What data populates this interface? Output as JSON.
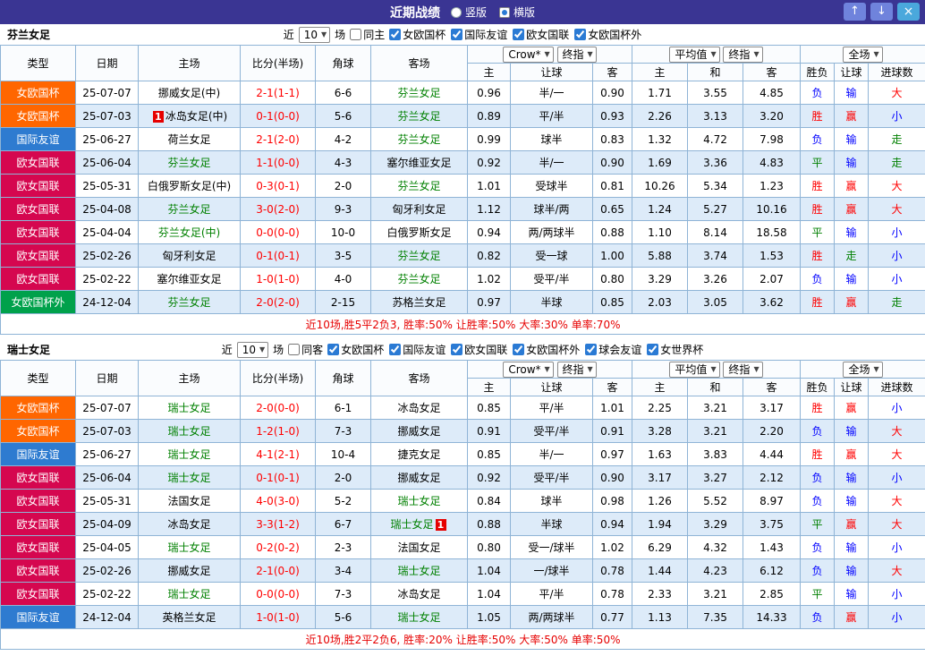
{
  "header": {
    "title": "近期战绩",
    "radios": [
      {
        "label": "竖版",
        "selected": false
      },
      {
        "label": "横版",
        "selected": true
      }
    ],
    "up": "↑",
    "down": "↓",
    "close": "×"
  },
  "type_colors": {
    "女欧国杯": "#ff6600",
    "国际友谊": "#2e7bd0",
    "欧女国联": "#d5074f",
    "女欧国杯外": "#00a14b"
  },
  "table_headers": {
    "type": "类型",
    "date": "日期",
    "home": "主场",
    "score": "比分(半场)",
    "corner": "角球",
    "away": "客场",
    "sub": [
      "主",
      "让球",
      "客",
      "主",
      "和",
      "客",
      "胜负",
      "让球",
      "进球数"
    ],
    "company": "Crow*",
    "final1": "终指",
    "average": "平均值",
    "final2": "终指",
    "scope": "全场"
  },
  "sections": [
    {
      "team": "芬兰女足",
      "filter": {
        "near": "近",
        "count": "10",
        "games": "场",
        "same": "同主",
        "same_checked": false,
        "comps": [
          {
            "label": "女欧国杯",
            "checked": true
          },
          {
            "label": "国际友谊",
            "checked": true
          },
          {
            "label": "欧女国联",
            "checked": true
          },
          {
            "label": "女欧国杯外",
            "checked": true
          }
        ]
      },
      "rows": [
        {
          "type": "女欧国杯",
          "date": "25-07-07",
          "home": "挪威女足(中)",
          "hf": false,
          "hc": 0,
          "score": "2-1(1-1)",
          "corner": "6-6",
          "away": "芬兰女足",
          "af": true,
          "ac": 0,
          "o": [
            "0.96",
            "半/一",
            "0.90",
            "1.71",
            "3.55",
            "4.85"
          ],
          "r": [
            "负",
            "输",
            "大"
          ]
        },
        {
          "type": "女欧国杯",
          "date": "25-07-03",
          "home": "冰岛女足(中)",
          "hf": false,
          "hc": 1,
          "score": "0-1(0-0)",
          "corner": "5-6",
          "away": "芬兰女足",
          "af": true,
          "ac": 0,
          "o": [
            "0.89",
            "平/半",
            "0.93",
            "2.26",
            "3.13",
            "3.20"
          ],
          "r": [
            "胜",
            "赢",
            "小"
          ]
        },
        {
          "type": "国际友谊",
          "date": "25-06-27",
          "home": "荷兰女足",
          "hf": false,
          "hc": 0,
          "score": "2-1(2-0)",
          "corner": "4-2",
          "away": "芬兰女足",
          "af": true,
          "ac": 0,
          "o": [
            "0.99",
            "球半",
            "0.83",
            "1.32",
            "4.72",
            "7.98"
          ],
          "r": [
            "负",
            "输",
            "走"
          ]
        },
        {
          "type": "欧女国联",
          "date": "25-06-04",
          "home": "芬兰女足",
          "hf": true,
          "hc": 0,
          "score": "1-1(0-0)",
          "corner": "4-3",
          "away": "塞尔维亚女足",
          "af": false,
          "ac": 0,
          "o": [
            "0.92",
            "半/一",
            "0.90",
            "1.69",
            "3.36",
            "4.83"
          ],
          "r": [
            "平",
            "输",
            "走"
          ]
        },
        {
          "type": "欧女国联",
          "date": "25-05-31",
          "home": "白俄罗斯女足(中)",
          "hf": false,
          "hc": 0,
          "score": "0-3(0-1)",
          "corner": "2-0",
          "away": "芬兰女足",
          "af": true,
          "ac": 0,
          "o": [
            "1.01",
            "受球半",
            "0.81",
            "10.26",
            "5.34",
            "1.23"
          ],
          "r": [
            "胜",
            "赢",
            "大"
          ]
        },
        {
          "type": "欧女国联",
          "date": "25-04-08",
          "home": "芬兰女足",
          "hf": true,
          "hc": 0,
          "score": "3-0(2-0)",
          "corner": "9-3",
          "away": "匈牙利女足",
          "af": false,
          "ac": 0,
          "o": [
            "1.12",
            "球半/两",
            "0.65",
            "1.24",
            "5.27",
            "10.16"
          ],
          "r": [
            "胜",
            "赢",
            "大"
          ]
        },
        {
          "type": "欧女国联",
          "date": "25-04-04",
          "home": "芬兰女足(中)",
          "hf": true,
          "hc": 0,
          "score": "0-0(0-0)",
          "corner": "10-0",
          "away": "白俄罗斯女足",
          "af": false,
          "ac": 0,
          "o": [
            "0.94",
            "两/两球半",
            "0.88",
            "1.10",
            "8.14",
            "18.58"
          ],
          "r": [
            "平",
            "输",
            "小"
          ]
        },
        {
          "type": "欧女国联",
          "date": "25-02-26",
          "home": "匈牙利女足",
          "hf": false,
          "hc": 0,
          "score": "0-1(0-1)",
          "corner": "3-5",
          "away": "芬兰女足",
          "af": true,
          "ac": 0,
          "o": [
            "0.82",
            "受一球",
            "1.00",
            "5.88",
            "3.74",
            "1.53"
          ],
          "r": [
            "胜",
            "走",
            "小"
          ]
        },
        {
          "type": "欧女国联",
          "date": "25-02-22",
          "home": "塞尔维亚女足",
          "hf": false,
          "hc": 0,
          "score": "1-0(1-0)",
          "corner": "4-0",
          "away": "芬兰女足",
          "af": true,
          "ac": 0,
          "o": [
            "1.02",
            "受平/半",
            "0.80",
            "3.29",
            "3.26",
            "2.07"
          ],
          "r": [
            "负",
            "输",
            "小"
          ]
        },
        {
          "type": "女欧国杯外",
          "date": "24-12-04",
          "home": "芬兰女足",
          "hf": true,
          "hc": 0,
          "score": "2-0(2-0)",
          "corner": "2-15",
          "away": "苏格兰女足",
          "af": false,
          "ac": 0,
          "o": [
            "0.97",
            "半球",
            "0.85",
            "2.03",
            "3.05",
            "3.62"
          ],
          "r": [
            "胜",
            "赢",
            "走"
          ]
        }
      ],
      "summary": "近10场,胜5平2负3, 胜率:50% 让胜率:50% 大率:30% 单率:70%"
    },
    {
      "team": "瑞士女足",
      "filter": {
        "near": "近",
        "count": "10",
        "games": "场",
        "same": "同客",
        "same_checked": false,
        "comps": [
          {
            "label": "女欧国杯",
            "checked": true
          },
          {
            "label": "国际友谊",
            "checked": true
          },
          {
            "label": "欧女国联",
            "checked": true
          },
          {
            "label": "女欧国杯外",
            "checked": true
          },
          {
            "label": "球会友谊",
            "checked": true
          },
          {
            "label": "女世界杯",
            "checked": true
          }
        ]
      },
      "rows": [
        {
          "type": "女欧国杯",
          "date": "25-07-07",
          "home": "瑞士女足",
          "hf": true,
          "hc": 0,
          "score": "2-0(0-0)",
          "corner": "6-1",
          "away": "冰岛女足",
          "af": false,
          "ac": 0,
          "o": [
            "0.85",
            "平/半",
            "1.01",
            "2.25",
            "3.21",
            "3.17"
          ],
          "r": [
            "胜",
            "赢",
            "小"
          ]
        },
        {
          "type": "女欧国杯",
          "date": "25-07-03",
          "home": "瑞士女足",
          "hf": true,
          "hc": 0,
          "score": "1-2(1-0)",
          "corner": "7-3",
          "away": "挪威女足",
          "af": false,
          "ac": 0,
          "o": [
            "0.91",
            "受平/半",
            "0.91",
            "3.28",
            "3.21",
            "2.20"
          ],
          "r": [
            "负",
            "输",
            "大"
          ]
        },
        {
          "type": "国际友谊",
          "date": "25-06-27",
          "home": "瑞士女足",
          "hf": true,
          "hc": 0,
          "score": "4-1(2-1)",
          "corner": "10-4",
          "away": "捷克女足",
          "af": false,
          "ac": 0,
          "o": [
            "0.85",
            "半/一",
            "0.97",
            "1.63",
            "3.83",
            "4.44"
          ],
          "r": [
            "胜",
            "赢",
            "大"
          ]
        },
        {
          "type": "欧女国联",
          "date": "25-06-04",
          "home": "瑞士女足",
          "hf": true,
          "hc": 0,
          "score": "0-1(0-1)",
          "corner": "2-0",
          "away": "挪威女足",
          "af": false,
          "ac": 0,
          "o": [
            "0.92",
            "受平/半",
            "0.90",
            "3.17",
            "3.27",
            "2.12"
          ],
          "r": [
            "负",
            "输",
            "小"
          ]
        },
        {
          "type": "欧女国联",
          "date": "25-05-31",
          "home": "法国女足",
          "hf": false,
          "hc": 0,
          "score": "4-0(3-0)",
          "corner": "5-2",
          "away": "瑞士女足",
          "af": true,
          "ac": 0,
          "o": [
            "0.84",
            "球半",
            "0.98",
            "1.26",
            "5.52",
            "8.97"
          ],
          "r": [
            "负",
            "输",
            "大"
          ]
        },
        {
          "type": "欧女国联",
          "date": "25-04-09",
          "home": "冰岛女足",
          "hf": false,
          "hc": 0,
          "score": "3-3(1-2)",
          "corner": "6-7",
          "away": "瑞士女足",
          "af": true,
          "ac": 1,
          "o": [
            "0.88",
            "半球",
            "0.94",
            "1.94",
            "3.29",
            "3.75"
          ],
          "r": [
            "平",
            "赢",
            "大"
          ]
        },
        {
          "type": "欧女国联",
          "date": "25-04-05",
          "home": "瑞士女足",
          "hf": true,
          "hc": 0,
          "score": "0-2(0-2)",
          "corner": "2-3",
          "away": "法国女足",
          "af": false,
          "ac": 0,
          "o": [
            "0.80",
            "受一/球半",
            "1.02",
            "6.29",
            "4.32",
            "1.43"
          ],
          "r": [
            "负",
            "输",
            "小"
          ]
        },
        {
          "type": "欧女国联",
          "date": "25-02-26",
          "home": "挪威女足",
          "hf": false,
          "hc": 0,
          "score": "2-1(0-0)",
          "corner": "3-4",
          "away": "瑞士女足",
          "af": true,
          "ac": 0,
          "o": [
            "1.04",
            "一/球半",
            "0.78",
            "1.44",
            "4.23",
            "6.12"
          ],
          "r": [
            "负",
            "输",
            "大"
          ]
        },
        {
          "type": "欧女国联",
          "date": "25-02-22",
          "home": "瑞士女足",
          "hf": true,
          "hc": 0,
          "score": "0-0(0-0)",
          "corner": "7-3",
          "away": "冰岛女足",
          "af": false,
          "ac": 0,
          "o": [
            "1.04",
            "平/半",
            "0.78",
            "2.33",
            "3.21",
            "2.85"
          ],
          "r": [
            "平",
            "输",
            "小"
          ]
        },
        {
          "type": "国际友谊",
          "date": "24-12-04",
          "home": "英格兰女足",
          "hf": false,
          "hc": 0,
          "score": "1-0(1-0)",
          "corner": "5-6",
          "away": "瑞士女足",
          "af": true,
          "ac": 0,
          "o": [
            "1.05",
            "两/两球半",
            "0.77",
            "1.13",
            "7.35",
            "14.33"
          ],
          "r": [
            "负",
            "赢",
            "小"
          ]
        }
      ],
      "summary": "近10场,胜2平2负6, 胜率:20% 让胜率:50% 大率:50% 单率:50%"
    }
  ]
}
